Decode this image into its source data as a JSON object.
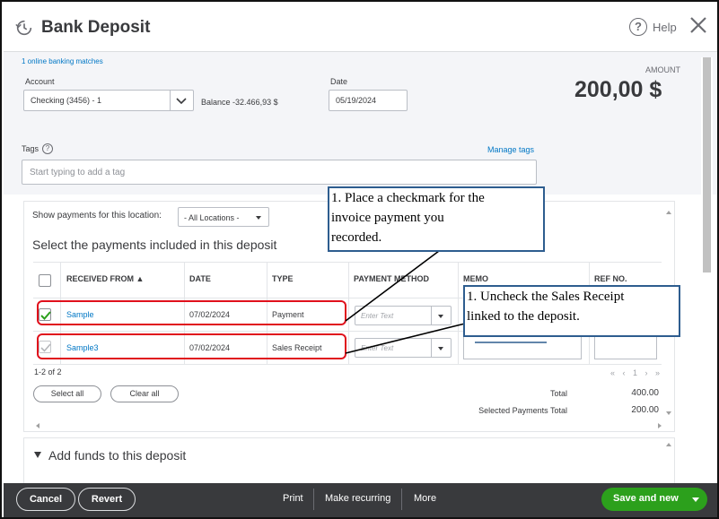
{
  "header": {
    "title": "Bank Deposit",
    "help_label": "Help"
  },
  "form": {
    "online_banking_matches": "1 online banking matches",
    "account_label": "Account",
    "account_value": "Checking (3456) - 1",
    "balance_label": "Balance",
    "balance_value": "-32.466,93 $",
    "date_label": "Date",
    "date_value": "05/19/2024",
    "amount_label": "AMOUNT",
    "amount_value": "200,00 $",
    "tags_label": "Tags",
    "manage_tags": "Manage tags",
    "tags_placeholder": "Start typing to add a tag"
  },
  "payments": {
    "show_label": "Show payments for this location:",
    "location_value": "- All Locations -",
    "section_title": "Select the payments included in this deposit",
    "columns": [
      "RECEIVED FROM ▲",
      "DATE",
      "TYPE",
      "PAYMENT METHOD",
      "MEMO",
      "REF NO."
    ],
    "rows": [
      {
        "received_from": "Sample",
        "date": "07/02/2024",
        "type": "Payment",
        "payment_method_placeholder": "Enter Text",
        "checked": true
      },
      {
        "received_from": "Sample3",
        "date": "07/02/2024",
        "type": "Sales Receipt",
        "payment_method_placeholder": "Enter Text",
        "checked": false
      }
    ],
    "count": "1-2 of 2",
    "pager": "« ‹ 1 › »",
    "select_all": "Select all",
    "clear_all": "Clear all",
    "total_label": "Total",
    "total_value": "400.00",
    "selected_total_label": "Selected Payments Total",
    "selected_total_value": "200.00"
  },
  "add_funds": {
    "title": "Add funds to this deposit"
  },
  "footer": {
    "cancel": "Cancel",
    "revert": "Revert",
    "print": "Print",
    "make_recurring": "Make recurring",
    "more": "More",
    "save_and_new": "Save and new"
  },
  "annotations": {
    "callout_1": [
      "1. Place a checkmark for the",
      "invoice payment you",
      "recorded."
    ],
    "callout_2": [
      "1. Uncheck the Sales Receipt",
      "linked to the deposit."
    ]
  },
  "colors": {
    "accent_link": "#0077c5",
    "highlight": "#e0101c",
    "save_green": "#2ca01c",
    "callout_border": "#2e5d8f",
    "footer_bg": "#393a3d"
  }
}
